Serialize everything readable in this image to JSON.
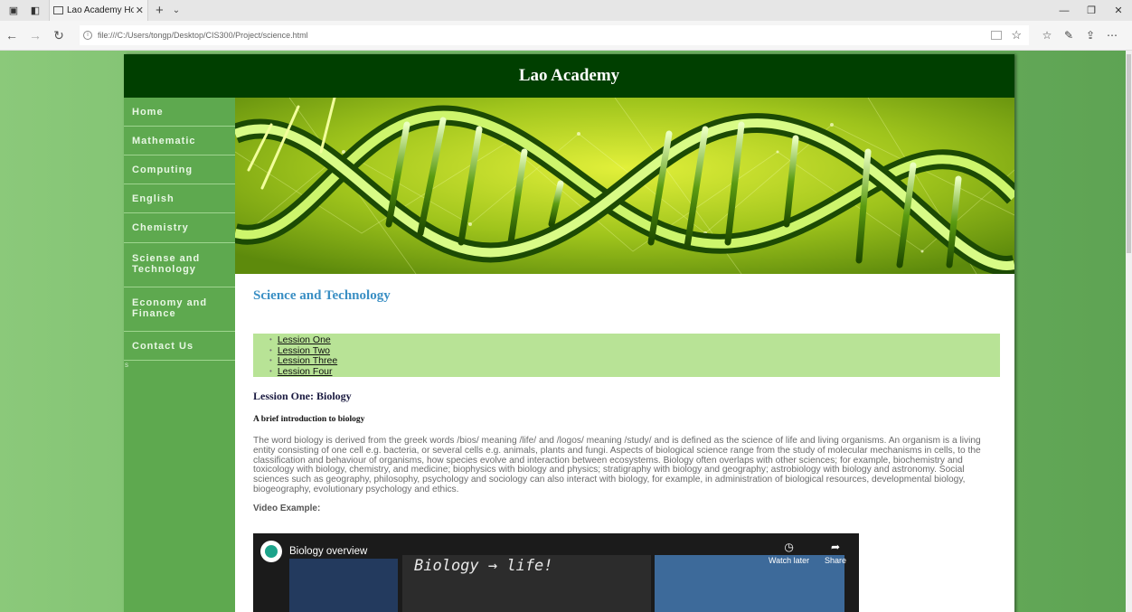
{
  "browser": {
    "tab_title": "Lao Academy Home Paç",
    "url": "file:///C:/Users/tongp/Desktop/CIS300/Project/science.html"
  },
  "site": {
    "title": "Lao Academy",
    "header_bg": "#003f00",
    "sidebar_bg": "#5ea94f",
    "nav": [
      {
        "label": "Home"
      },
      {
        "label": "Mathematic"
      },
      {
        "label": "Computing"
      },
      {
        "label": "English"
      },
      {
        "label": "Chemistry"
      },
      {
        "label": "Sciense and Technology"
      },
      {
        "label": "Economy and Finance"
      },
      {
        "label": "Contact Us"
      }
    ],
    "sidebar_note": "s"
  },
  "main": {
    "page_title": "Science and Technology",
    "lessons": [
      "Lession One",
      "Lession Two",
      "Lession Three",
      "Lession Four"
    ],
    "lesson_heading": "Lession One: Biology",
    "lesson_subheading": "A brief introduction to biology",
    "lesson_body": "The word biology is derived from the greek words /bios/ meaning /life/ and /logos/ meaning /study/ and is defined as the science of life and living organisms. An organism is a living entity consisting of one cell e.g. bacteria, or several cells e.g. animals, plants and fungi. Aspects of biological science range from the study of molecular mechanisms in cells, to the classification and behaviour of organisms, how species evolve and interaction between ecosystems. Biology often overlaps with other sciences; for example, biochemistry and toxicology with biology, chemistry, and medicine; biophysics with biology and physics; stratigraphy with biology and geography; astrobiology with biology and astronomy. Social sciences such as geography, philosophy, psychology and sociology can also interact with biology, for example, in administration of biological resources, developmental biology, biogeography, evolutionary psychology and ethics.",
    "video_label": "Video Example:"
  },
  "video": {
    "title": "Biology overview",
    "watch_later": "Watch later",
    "share": "Share",
    "chalk_text": "Biology → life!"
  }
}
